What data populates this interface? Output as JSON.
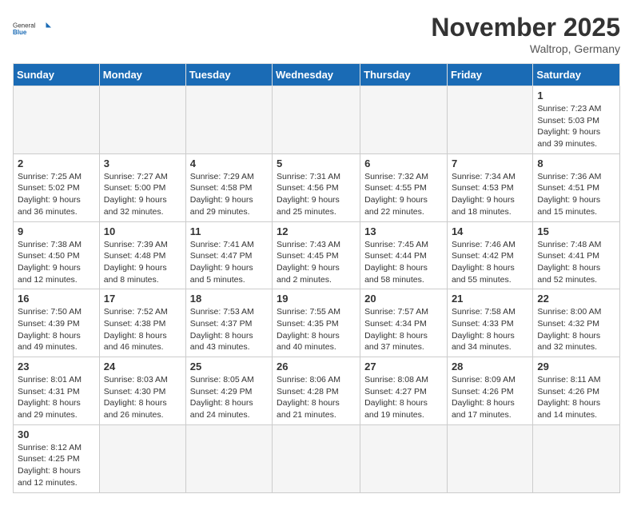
{
  "logo": {
    "text_general": "General",
    "text_blue": "Blue"
  },
  "title": "November 2025",
  "location": "Waltrop, Germany",
  "days_of_week": [
    "Sunday",
    "Monday",
    "Tuesday",
    "Wednesday",
    "Thursday",
    "Friday",
    "Saturday"
  ],
  "weeks": [
    [
      {
        "day": "",
        "info": ""
      },
      {
        "day": "",
        "info": ""
      },
      {
        "day": "",
        "info": ""
      },
      {
        "day": "",
        "info": ""
      },
      {
        "day": "",
        "info": ""
      },
      {
        "day": "",
        "info": ""
      },
      {
        "day": "1",
        "info": "Sunrise: 7:23 AM\nSunset: 5:03 PM\nDaylight: 9 hours and 39 minutes."
      }
    ],
    [
      {
        "day": "2",
        "info": "Sunrise: 7:25 AM\nSunset: 5:02 PM\nDaylight: 9 hours and 36 minutes."
      },
      {
        "day": "3",
        "info": "Sunrise: 7:27 AM\nSunset: 5:00 PM\nDaylight: 9 hours and 32 minutes."
      },
      {
        "day": "4",
        "info": "Sunrise: 7:29 AM\nSunset: 4:58 PM\nDaylight: 9 hours and 29 minutes."
      },
      {
        "day": "5",
        "info": "Sunrise: 7:31 AM\nSunset: 4:56 PM\nDaylight: 9 hours and 25 minutes."
      },
      {
        "day": "6",
        "info": "Sunrise: 7:32 AM\nSunset: 4:55 PM\nDaylight: 9 hours and 22 minutes."
      },
      {
        "day": "7",
        "info": "Sunrise: 7:34 AM\nSunset: 4:53 PM\nDaylight: 9 hours and 18 minutes."
      },
      {
        "day": "8",
        "info": "Sunrise: 7:36 AM\nSunset: 4:51 PM\nDaylight: 9 hours and 15 minutes."
      }
    ],
    [
      {
        "day": "9",
        "info": "Sunrise: 7:38 AM\nSunset: 4:50 PM\nDaylight: 9 hours and 12 minutes."
      },
      {
        "day": "10",
        "info": "Sunrise: 7:39 AM\nSunset: 4:48 PM\nDaylight: 9 hours and 8 minutes."
      },
      {
        "day": "11",
        "info": "Sunrise: 7:41 AM\nSunset: 4:47 PM\nDaylight: 9 hours and 5 minutes."
      },
      {
        "day": "12",
        "info": "Sunrise: 7:43 AM\nSunset: 4:45 PM\nDaylight: 9 hours and 2 minutes."
      },
      {
        "day": "13",
        "info": "Sunrise: 7:45 AM\nSunset: 4:44 PM\nDaylight: 8 hours and 58 minutes."
      },
      {
        "day": "14",
        "info": "Sunrise: 7:46 AM\nSunset: 4:42 PM\nDaylight: 8 hours and 55 minutes."
      },
      {
        "day": "15",
        "info": "Sunrise: 7:48 AM\nSunset: 4:41 PM\nDaylight: 8 hours and 52 minutes."
      }
    ],
    [
      {
        "day": "16",
        "info": "Sunrise: 7:50 AM\nSunset: 4:39 PM\nDaylight: 8 hours and 49 minutes."
      },
      {
        "day": "17",
        "info": "Sunrise: 7:52 AM\nSunset: 4:38 PM\nDaylight: 8 hours and 46 minutes."
      },
      {
        "day": "18",
        "info": "Sunrise: 7:53 AM\nSunset: 4:37 PM\nDaylight: 8 hours and 43 minutes."
      },
      {
        "day": "19",
        "info": "Sunrise: 7:55 AM\nSunset: 4:35 PM\nDaylight: 8 hours and 40 minutes."
      },
      {
        "day": "20",
        "info": "Sunrise: 7:57 AM\nSunset: 4:34 PM\nDaylight: 8 hours and 37 minutes."
      },
      {
        "day": "21",
        "info": "Sunrise: 7:58 AM\nSunset: 4:33 PM\nDaylight: 8 hours and 34 minutes."
      },
      {
        "day": "22",
        "info": "Sunrise: 8:00 AM\nSunset: 4:32 PM\nDaylight: 8 hours and 32 minutes."
      }
    ],
    [
      {
        "day": "23",
        "info": "Sunrise: 8:01 AM\nSunset: 4:31 PM\nDaylight: 8 hours and 29 minutes."
      },
      {
        "day": "24",
        "info": "Sunrise: 8:03 AM\nSunset: 4:30 PM\nDaylight: 8 hours and 26 minutes."
      },
      {
        "day": "25",
        "info": "Sunrise: 8:05 AM\nSunset: 4:29 PM\nDaylight: 8 hours and 24 minutes."
      },
      {
        "day": "26",
        "info": "Sunrise: 8:06 AM\nSunset: 4:28 PM\nDaylight: 8 hours and 21 minutes."
      },
      {
        "day": "27",
        "info": "Sunrise: 8:08 AM\nSunset: 4:27 PM\nDaylight: 8 hours and 19 minutes."
      },
      {
        "day": "28",
        "info": "Sunrise: 8:09 AM\nSunset: 4:26 PM\nDaylight: 8 hours and 17 minutes."
      },
      {
        "day": "29",
        "info": "Sunrise: 8:11 AM\nSunset: 4:26 PM\nDaylight: 8 hours and 14 minutes."
      }
    ],
    [
      {
        "day": "30",
        "info": "Sunrise: 8:12 AM\nSunset: 4:25 PM\nDaylight: 8 hours and 12 minutes."
      },
      {
        "day": "",
        "info": ""
      },
      {
        "day": "",
        "info": ""
      },
      {
        "day": "",
        "info": ""
      },
      {
        "day": "",
        "info": ""
      },
      {
        "day": "",
        "info": ""
      },
      {
        "day": "",
        "info": ""
      }
    ]
  ]
}
